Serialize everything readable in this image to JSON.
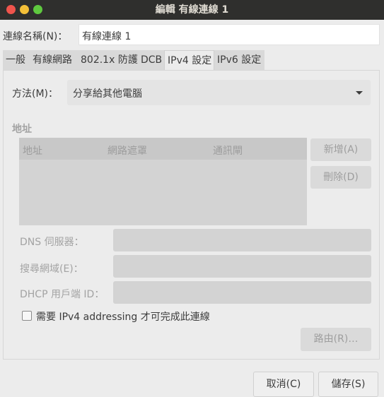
{
  "window": {
    "title": "編輯 有線連線 1"
  },
  "connection_name": {
    "label": "連線名稱(N)：",
    "value": "有線連線 1"
  },
  "tabs": [
    {
      "label": "一般"
    },
    {
      "label": "有線網路"
    },
    {
      "label": "802.1x 防護"
    },
    {
      "label": "DCB"
    },
    {
      "label": "IPv4 設定"
    },
    {
      "label": "IPv6 設定"
    }
  ],
  "ipv4": {
    "method_label": "方法(M)：",
    "method_value": "分享給其他電腦",
    "section_title": "地址",
    "table_headers": [
      "地址",
      "網路遮罩",
      "通訊閘"
    ],
    "add_button": "新增(A)",
    "delete_button": "刪除(D)",
    "dns_label": "DNS 伺服器：",
    "search_domains_label": "搜尋網域(E)：",
    "dhcp_client_id_label": "DHCP 用戶端 ID：",
    "require_ipv4_label": "需要 IPv4 addressing 才可完成此連線",
    "routes_button": "路由(R)…"
  },
  "footer": {
    "cancel": "取消(C)",
    "save": "儲存(S)"
  }
}
